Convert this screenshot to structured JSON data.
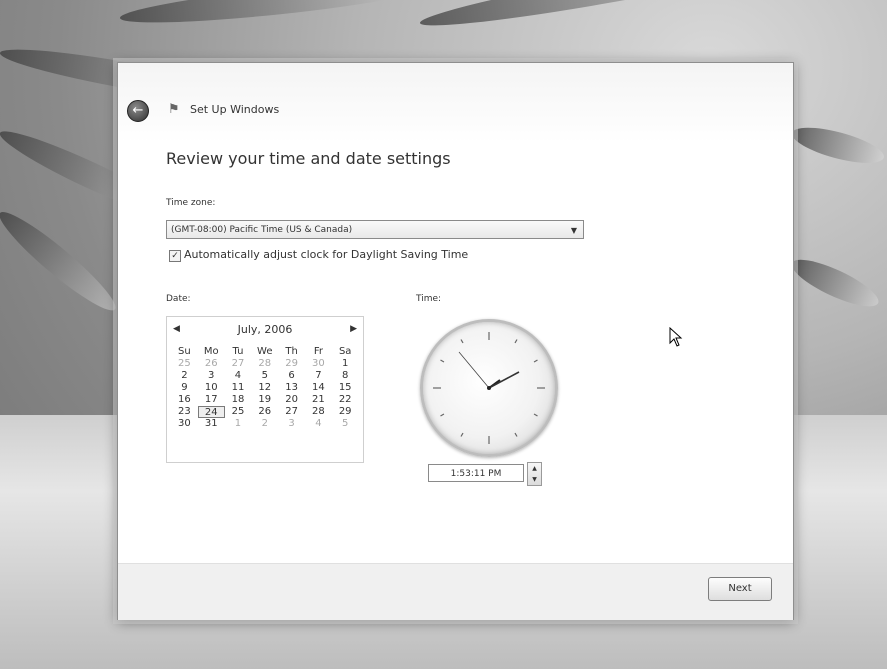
{
  "window": {
    "title": "Set Up Windows",
    "heading": "Review your time and date settings"
  },
  "timezone": {
    "label": "Time zone:",
    "selected": "(GMT-08:00) Pacific Time (US & Canada)"
  },
  "dst": {
    "label": "Automatically adjust clock for Daylight Saving Time",
    "checked": true
  },
  "date": {
    "label": "Date:",
    "month_year": "July, 2006",
    "weekdays": [
      "Su",
      "Mo",
      "Tu",
      "We",
      "Th",
      "Fr",
      "Sa"
    ],
    "weeks": [
      [
        "25",
        "26",
        "27",
        "28",
        "29",
        "30",
        "1"
      ],
      [
        "2",
        "3",
        "4",
        "5",
        "6",
        "7",
        "8"
      ],
      [
        "9",
        "10",
        "11",
        "12",
        "13",
        "14",
        "15"
      ],
      [
        "16",
        "17",
        "18",
        "19",
        "20",
        "21",
        "22"
      ],
      [
        "23",
        "24",
        "25",
        "26",
        "27",
        "28",
        "29"
      ],
      [
        "30",
        "31",
        "1",
        "2",
        "3",
        "4",
        "5"
      ]
    ],
    "selected_day": "24"
  },
  "time": {
    "label": "Time:",
    "value": "1:53:11 PM"
  },
  "footer": {
    "next_label": "Next"
  },
  "icons": {
    "back": "back-arrow-icon",
    "window": "windows-flag-icon",
    "dropdown": "dropdown-arrow-icon",
    "prev_month": "prev-month-icon",
    "next_month": "next-month-icon"
  }
}
